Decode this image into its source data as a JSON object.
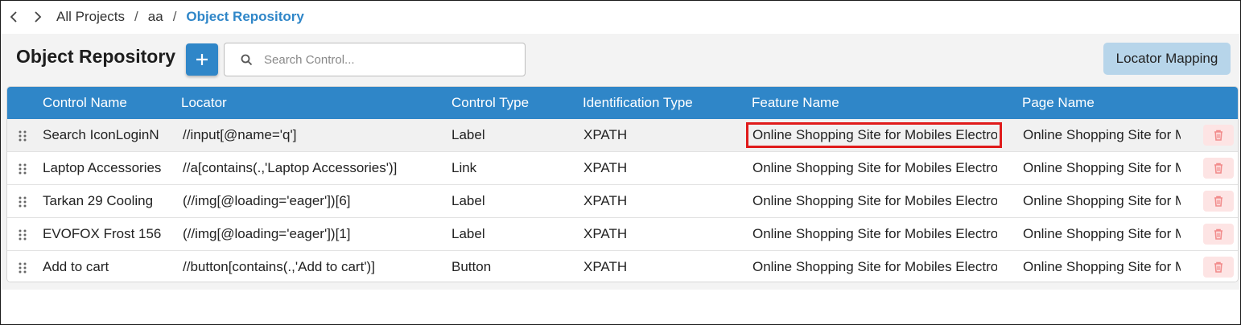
{
  "breadcrumb": {
    "items": [
      "All Projects",
      "aa"
    ],
    "separator": "/",
    "current": "Object Repository"
  },
  "page": {
    "title": "Object Repository",
    "add_icon": "plus-icon"
  },
  "search": {
    "placeholder": "Search Control...",
    "value": "",
    "icon": "search-icon"
  },
  "locator_mapping_label": "Locator Mapping",
  "table": {
    "columns": [
      "Control Name",
      "Locator",
      "Control Type",
      "Identification Type",
      "Feature Name",
      "Page Name"
    ],
    "rows": [
      {
        "name": "Search IconLoginN",
        "locator": "//input[@name='q']",
        "type": "Label",
        "id_type": "XPATH",
        "feature": "Online Shopping Site for Mobiles Electro",
        "page": "Online Shopping Site for M"
      },
      {
        "name": "Laptop Accessories",
        "locator": "//a[contains(.,'Laptop Accessories')]",
        "type": "Link",
        "id_type": "XPATH",
        "feature": "Online Shopping Site for Mobiles Electro",
        "page": "Online Shopping Site for M"
      },
      {
        "name": "Tarkan 29 Cooling",
        "locator": "(//img[@loading='eager'])[6]",
        "type": "Label",
        "id_type": "XPATH",
        "feature": "Online Shopping Site for Mobiles Electro",
        "page": "Online Shopping Site for M"
      },
      {
        "name": "EVOFOX Frost 156",
        "locator": "(//img[@loading='eager'])[1]",
        "type": "Label",
        "id_type": "XPATH",
        "feature": "Online Shopping Site for Mobiles Electro",
        "page": "Online Shopping Site for M"
      },
      {
        "name": "Add to cart",
        "locator": "//button[contains(.,'Add to cart')]",
        "type": "Button",
        "id_type": "XPATH",
        "feature": "Online Shopping Site for Mobiles Electro",
        "page": "Online Shopping Site for M"
      }
    ],
    "highlighted_cell": {
      "row": 0,
      "column": "Feature Name"
    }
  },
  "colors": {
    "accent": "#2f86c8",
    "locator_button_bg": "#b7d5ea",
    "delete_bg": "#fde4e4",
    "delete_icon": "#f28b8b",
    "highlight_border": "#e01b1b",
    "panel_bg": "#f3f3f3"
  }
}
